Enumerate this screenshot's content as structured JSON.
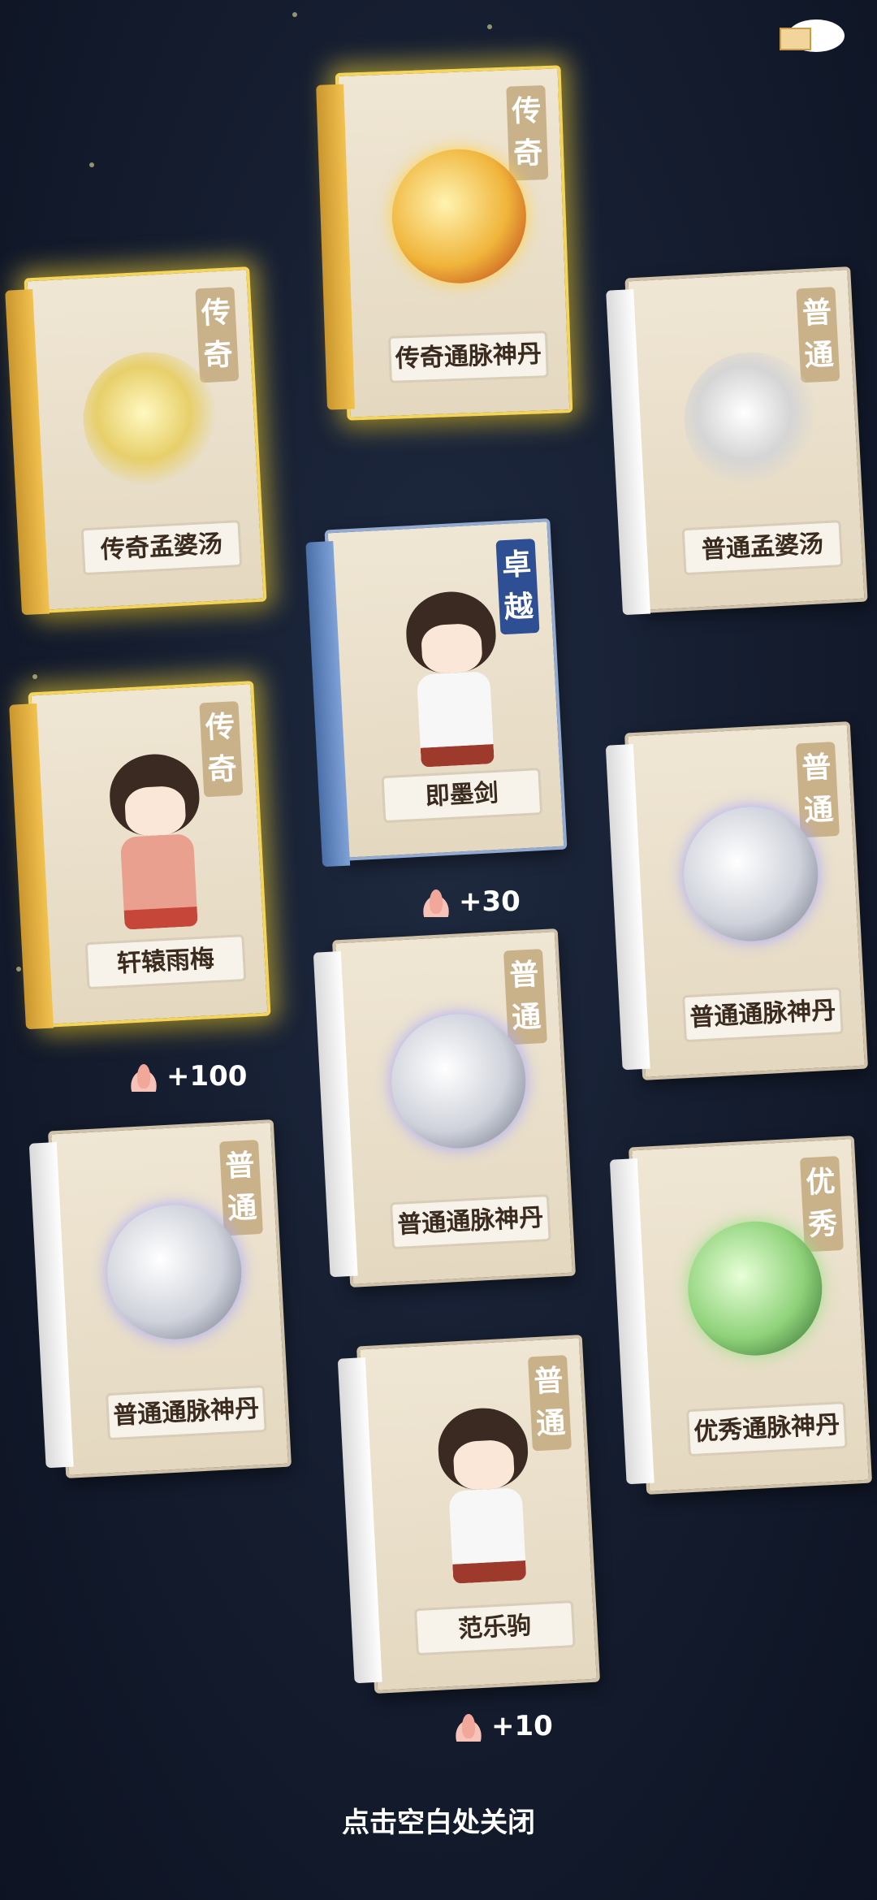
{
  "cards": [
    {
      "rank": [
        "传",
        "奇"
      ],
      "name": "传奇通脉神丹",
      "type": "orb-gold",
      "legend": true
    },
    {
      "rank": [
        "传",
        "奇"
      ],
      "name": "传奇孟婆汤",
      "type": "moon-gold",
      "legend": true
    },
    {
      "rank": [
        "普",
        "通"
      ],
      "name": "普通孟婆汤",
      "type": "moon-silver",
      "legend": false
    },
    {
      "rank": [
        "卓",
        "越"
      ],
      "name": "即墨剑",
      "type": "char",
      "legend": false,
      "rare": true
    },
    {
      "rank": [
        "传",
        "奇"
      ],
      "name": "轩辕雨梅",
      "type": "char-red",
      "legend": true
    },
    {
      "rank": [
        "普",
        "通"
      ],
      "name": "普通通脉神丹",
      "type": "orb-silver",
      "legend": false
    },
    {
      "rank": [
        "普",
        "通"
      ],
      "name": "普通通脉神丹",
      "type": "orb-silver",
      "legend": false
    },
    {
      "rank": [
        "普",
        "通"
      ],
      "name": "普通通脉神丹",
      "type": "orb-silver",
      "legend": false
    },
    {
      "rank": [
        "优",
        "秀"
      ],
      "name": "优秀通脉神丹",
      "type": "orb-green",
      "legend": false
    },
    {
      "rank": [
        "普",
        "通"
      ],
      "name": "范乐驹",
      "type": "char",
      "legend": false
    }
  ],
  "bonuses": {
    "b1": "+30",
    "b2": "+100",
    "b3": "+10"
  },
  "close_hint": "点击空白处关闭",
  "colors": {
    "legend_glow": "#f4d55a",
    "rare_badge": "#2e4f94",
    "common_badge": "#c9b28a"
  }
}
